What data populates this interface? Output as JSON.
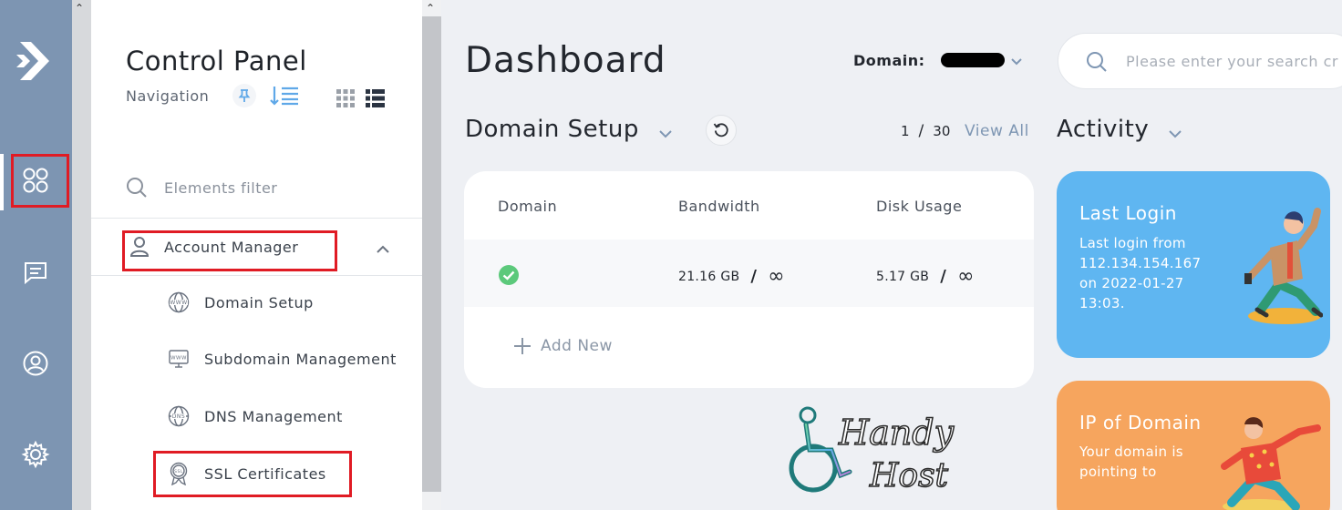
{
  "rail": {
    "items": [
      {
        "name": "dashboard",
        "icon": "apps-grid-icon"
      },
      {
        "name": "messages",
        "icon": "chat-icon"
      },
      {
        "name": "account",
        "icon": "user-circle-icon"
      },
      {
        "name": "settings",
        "icon": "gear-icon"
      }
    ]
  },
  "nav": {
    "title": "Control Panel",
    "subtitle": "Navigation",
    "filter_placeholder": "Elements filter",
    "section": "Account Manager",
    "items": [
      {
        "label": "Domain Setup",
        "icon": "www-globe-icon"
      },
      {
        "label": "Subdomain Management",
        "icon": "www-monitor-icon"
      },
      {
        "label": "DNS Management",
        "icon": "dns-globe-icon"
      },
      {
        "label": "SSL Certificates",
        "icon": "ssl-badge-icon"
      }
    ]
  },
  "header": {
    "title": "Dashboard",
    "domain_label": "Domain:",
    "search_placeholder": "Please enter your search cr"
  },
  "domain_setup": {
    "title": "Domain Setup",
    "page_current": "1",
    "page_sep": "/",
    "page_total": "30",
    "view_all": "View All",
    "columns": [
      "Domain",
      "Bandwidth",
      "Disk Usage"
    ],
    "rows": [
      {
        "bandwidth": "21.16 GB",
        "disk": "5.17 GB",
        "sep": "/",
        "limit": "∞"
      }
    ],
    "add_new": "Add New"
  },
  "watermark": {
    "line1": "Handy",
    "line2": "Host"
  },
  "activity": {
    "title": "Activity",
    "tiles": [
      {
        "title": "Last Login",
        "body": "Last login from 112.134.154.167 on 2022-01-27 13:03."
      },
      {
        "title": "IP of Domain",
        "body": "Your domain is pointing to"
      }
    ]
  },
  "colors": {
    "rail": "#7d95b2",
    "accent": "#7e96b3",
    "highlight": "#e01b24",
    "success": "#5cc97b",
    "tile_blue": "#5fb6f1",
    "tile_orange": "#f6a55e"
  }
}
